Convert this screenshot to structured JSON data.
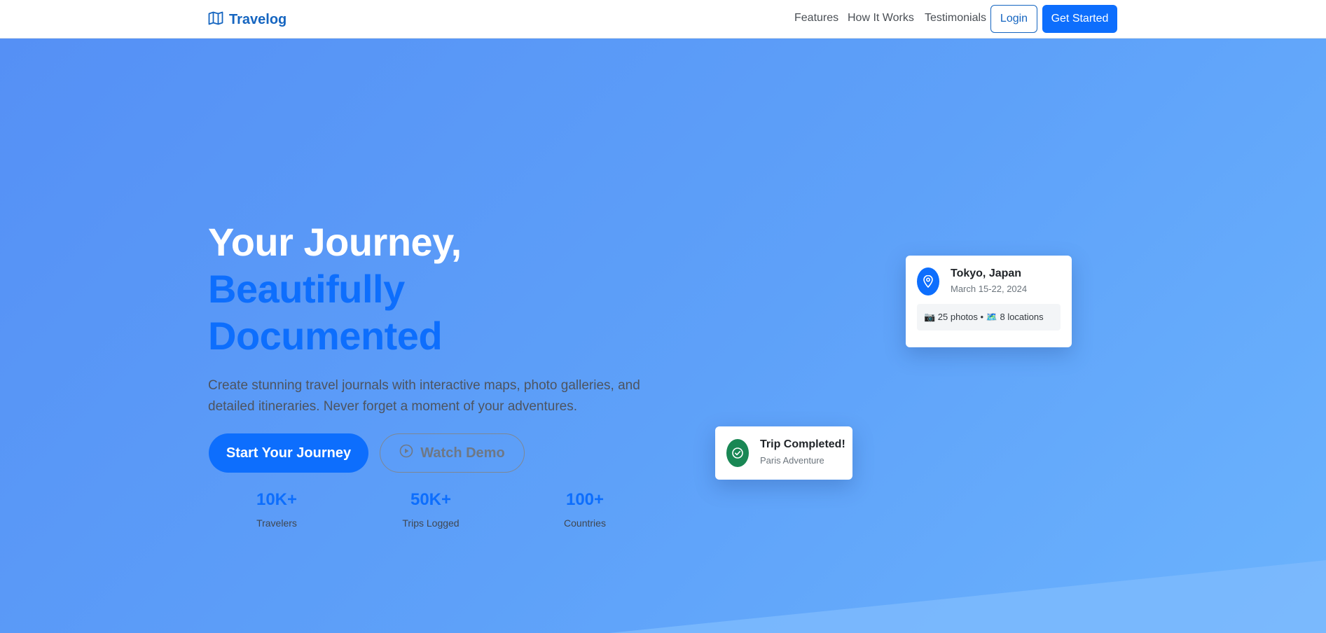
{
  "nav": {
    "brand": "Travelog",
    "brand_icon": "map-icon",
    "links": [
      "Features",
      "How It Works",
      "Testimonials"
    ],
    "login_label": "Login",
    "get_started_label": "Get Started"
  },
  "hero": {
    "heading_line1": "Your Journey,",
    "heading_line2": "Beautifully",
    "heading_line3": "Documented",
    "lead_line1": "Create stunning travel journals with interactive maps, photo galleries, and",
    "lead_line2": "detailed itineraries. Never forget a moment of your adventures.",
    "primary_cta": "Start Your Journey",
    "secondary_cta": "Watch Demo",
    "secondary_cta_icon": "play-circle-icon",
    "stats": [
      {
        "value": "10K+",
        "label": "Travelers"
      },
      {
        "value": "50K+",
        "label": "Trips Logged"
      },
      {
        "value": "100+",
        "label": "Countries"
      }
    ]
  },
  "trip_card": {
    "icon": "map-pin-icon",
    "title": "Tokyo, Japan",
    "dates": "March 15-22, 2024",
    "meta": "📷 25 photos • 🗺️ 8 locations"
  },
  "completed_card": {
    "icon": "check-circle-icon",
    "title": "Trip Completed!",
    "subtitle": "Paris Adventure"
  },
  "colors": {
    "primary": "#0d6efd",
    "brand": "#1565c0",
    "success": "#198754",
    "hero_gradient_start": "#5590f5",
    "hero_gradient_end": "#6bb3fd"
  }
}
